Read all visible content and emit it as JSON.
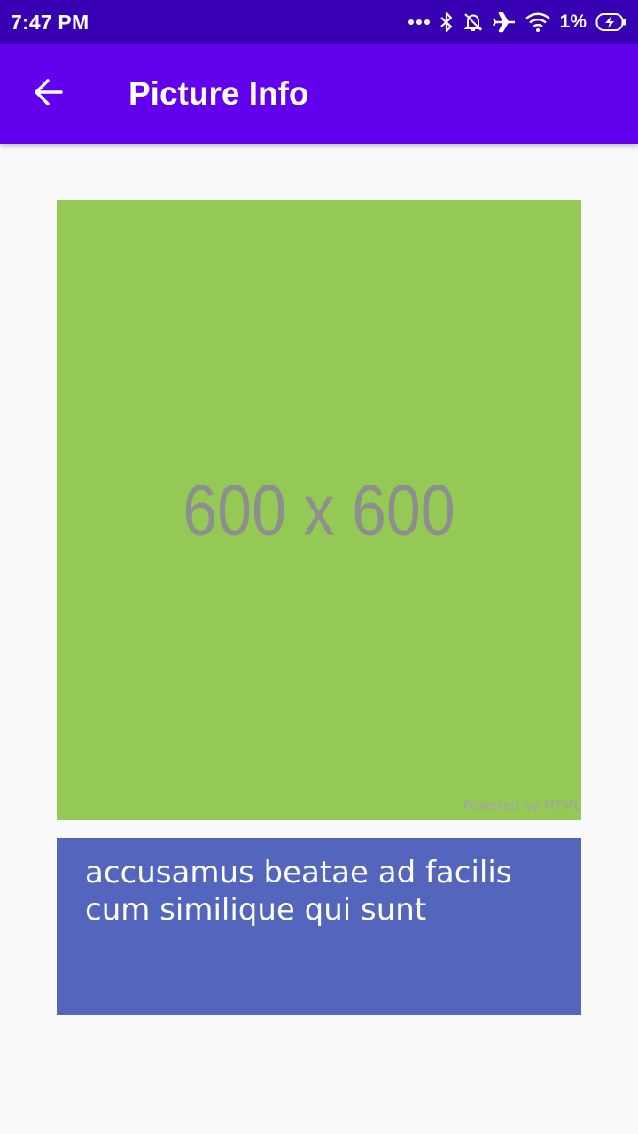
{
  "status_bar": {
    "time": "7:47 PM",
    "battery_percent": "1%",
    "icons": [
      "more-dots-icon",
      "bluetooth-icon",
      "notifications-off-icon",
      "airplane-icon",
      "wifi-icon",
      "battery-charging-icon"
    ]
  },
  "app_bar": {
    "title": "Picture Info",
    "back_icon": "arrow-back-icon",
    "color": "#6200ee"
  },
  "picture": {
    "placeholder_text": "600 x 600",
    "watermark": "Powered by HTML",
    "background_color": "#95c956"
  },
  "caption": {
    "text": "accusamus beatae ad facilis cum similique qui sunt",
    "background_color": "#5465be"
  },
  "colors": {
    "status_bar": "#3700b3",
    "page_background": "#fafafa"
  }
}
